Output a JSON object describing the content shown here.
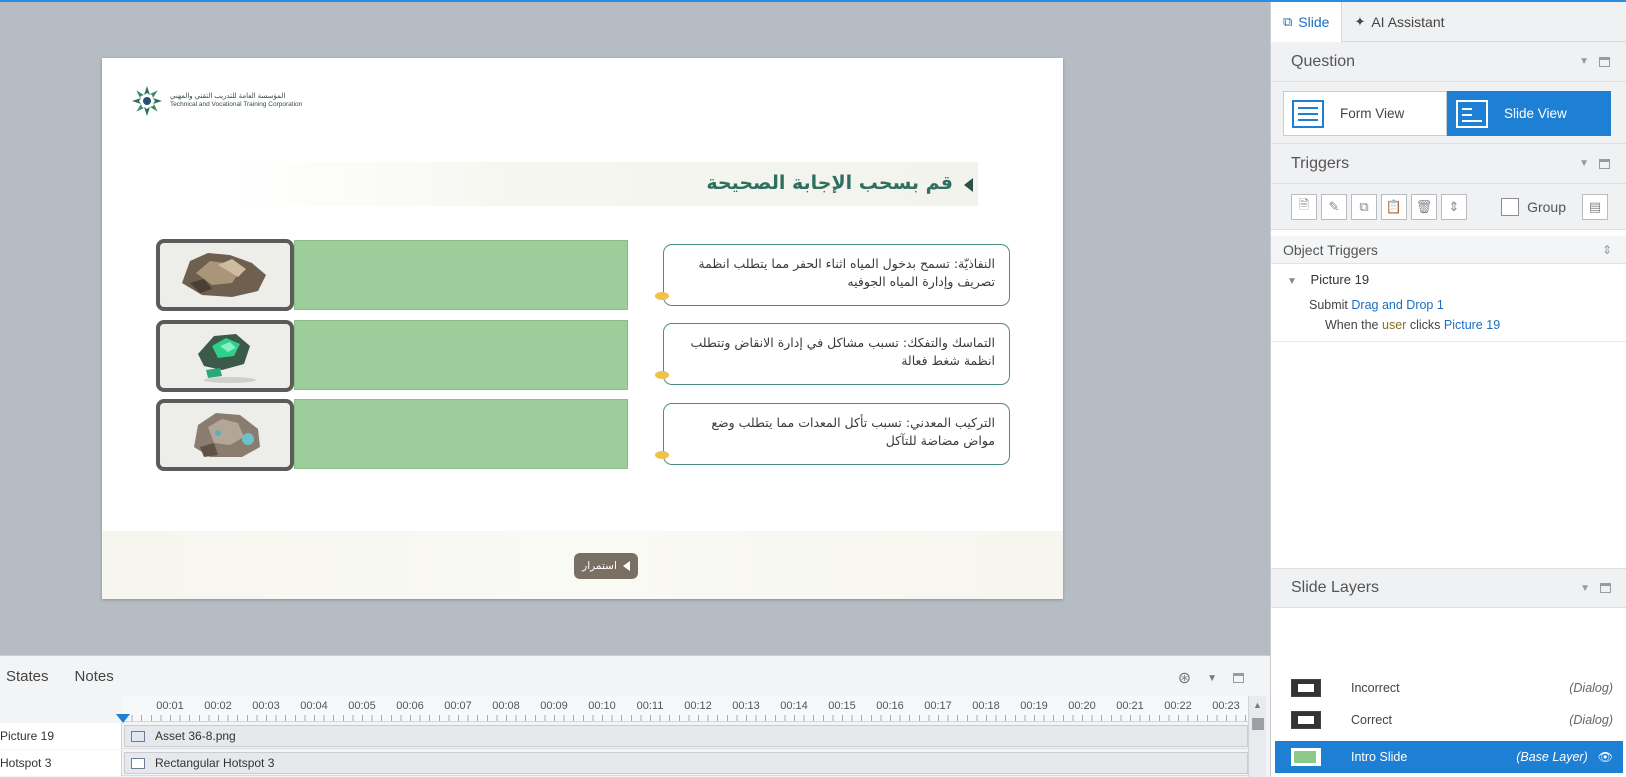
{
  "slide": {
    "logo": {
      "arabic": "المؤسسة العامة للتدريب التقني والمهني",
      "english": "Technical and Vocational Training Corporation"
    },
    "title": "قم بسحب الإجابة الصحيحة",
    "answers": [
      "النفاذيّة: تسمح بدخول المياه اثناء الحفر مما يتطلب انظمة تصريف وإدارة المياه الجوفيه",
      "التماسك والتفكك: تسبب مشاكل في إدارة الانقاض وتتطلب انظمة شغط فعالة",
      "التركيب المعدني: تسبب تأكل المعدات مما يتطلب وضع مواض مضاضة للتآكل"
    ],
    "continue_label": "استمرار"
  },
  "panel": {
    "tabs": [
      {
        "label": "Slide",
        "icon": "slide-icon"
      },
      {
        "label": "AI Assistant",
        "icon": "sparkle-icon"
      }
    ],
    "question": {
      "heading": "Question",
      "form_view": "Form View",
      "slide_view": "Slide View"
    },
    "triggers": {
      "heading": "Triggers",
      "group_label": "Group"
    },
    "object_triggers": {
      "heading": "Object Triggers",
      "object_name": "Picture 19",
      "action_verb": "Submit",
      "action_target": "Drag and Drop 1",
      "when_prefix": "When the",
      "when_user": "user",
      "when_verb": "clicks",
      "when_object": "Picture 19"
    },
    "layers": {
      "heading": "Slide Layers",
      "items": [
        {
          "name": "Incorrect",
          "kind": "(Dialog)"
        },
        {
          "name": "Correct",
          "kind": "(Dialog)"
        },
        {
          "name": "Intro Slide",
          "kind": "(Base Layer)"
        }
      ]
    }
  },
  "timeline": {
    "tabs": [
      "States",
      "Notes"
    ],
    "ticks": [
      "00:01",
      "00:02",
      "00:03",
      "00:04",
      "00:05",
      "00:06",
      "00:07",
      "00:08",
      "00:09",
      "00:10",
      "00:11",
      "00:12",
      "00:13",
      "00:14",
      "00:15",
      "00:16",
      "00:17",
      "00:18",
      "00:19",
      "00:20",
      "00:21",
      "00:22",
      "00:23"
    ],
    "rows": [
      {
        "name": "Picture 19",
        "bar": "Asset 36-8.png"
      },
      {
        "name": "Hotspot 3",
        "bar": "Rectangular Hotspot 3"
      }
    ]
  },
  "colors": {
    "accent": "#1e80d4",
    "title_green": "#2f6f62",
    "drop_zone": "#9dcd9b",
    "continue_button": "#7a6f63"
  }
}
